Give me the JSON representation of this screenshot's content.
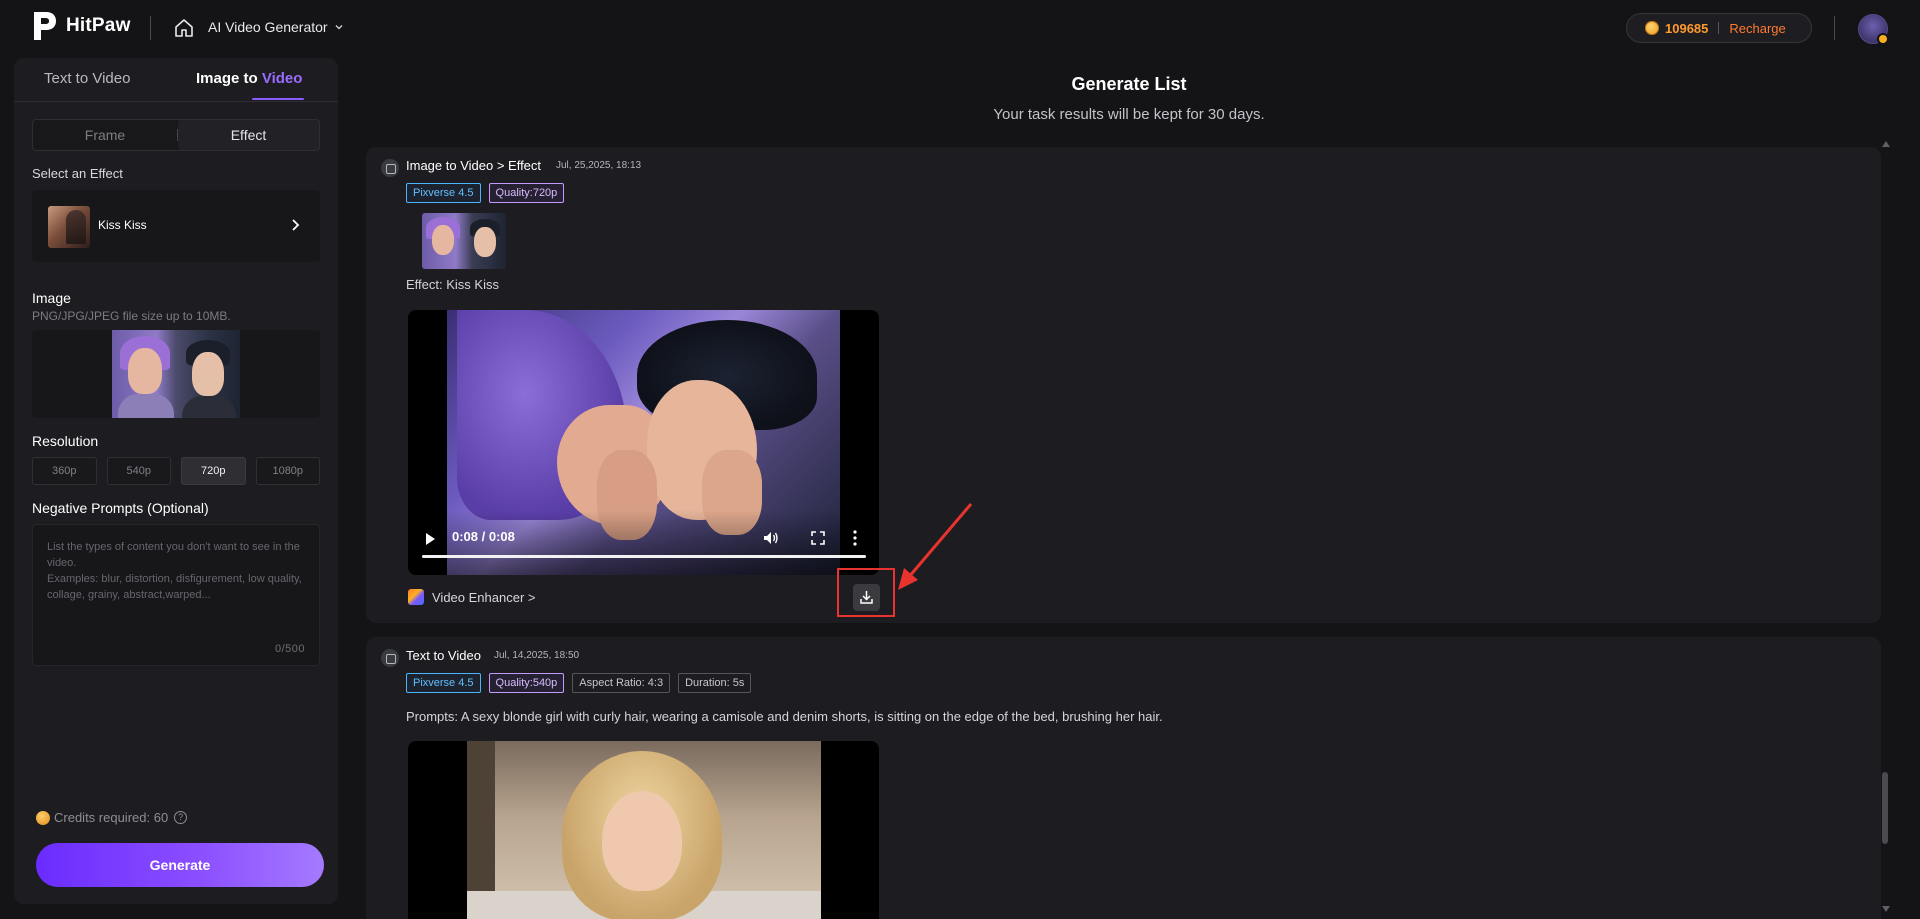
{
  "header": {
    "brand": "HitPaw",
    "breadcrumb": "AI Video Generator",
    "credits": "109685",
    "recharge": "Recharge"
  },
  "left_panel": {
    "tabs": [
      "Text to Video",
      "Image to Video"
    ],
    "tab_active_prefix": "Image to ",
    "tab_active_accent": "Video",
    "mode": {
      "frame": "Frame",
      "effect": "Effect"
    },
    "select_effect_label": "Select an Effect",
    "effect_name": "Kiss Kiss",
    "image_label": "Image",
    "image_hint": "PNG/JPG/JPEG file size up to 10MB.",
    "resolution_label": "Resolution",
    "resolutions": [
      "360p",
      "540p",
      "720p",
      "1080p"
    ],
    "resolution_selected": "720p",
    "negative_label": "Negative Prompts (Optional)",
    "negative_placeholder": "List the types of content you don't want to see in the video.\nExamples: blur, distortion, disfigurement, low quality, collage, grainy,  abstract,warped...",
    "negative_count": "0/500",
    "credits_required": "Credits required: 60",
    "generate": "Generate"
  },
  "main": {
    "title": "Generate List",
    "subtitle": "Your task results will be kept for 30 days.",
    "tasks": [
      {
        "title": "Image to Video > Effect",
        "date": "Jul, 25,2025, 18:13",
        "tags": [
          "Pixverse 4.5",
          "Quality:720p"
        ],
        "effect_text": "Effect: Kiss Kiss",
        "video_time": "0:08 / 0:08",
        "video_progress": 1.0,
        "enhancer": "Video Enhancer >"
      },
      {
        "title": "Text to Video",
        "date": "Jul, 14,2025, 18:50",
        "tags": [
          "Pixverse 4.5",
          "Quality:540p",
          "Aspect Ratio: 4:3",
          "Duration: 5s"
        ],
        "prompt_text": "Prompts: A sexy blonde girl with curly hair, wearing a camisole and denim shorts, is sitting on the edge of the bed, brushing her hair."
      }
    ]
  },
  "colors": {
    "accent_purple": "#8a5bff",
    "credits_orange": "#ff9a2e",
    "highlight_red": "#e8332e",
    "tag_blue": "#4bb4ff",
    "tag_purple": "#c39bff"
  }
}
